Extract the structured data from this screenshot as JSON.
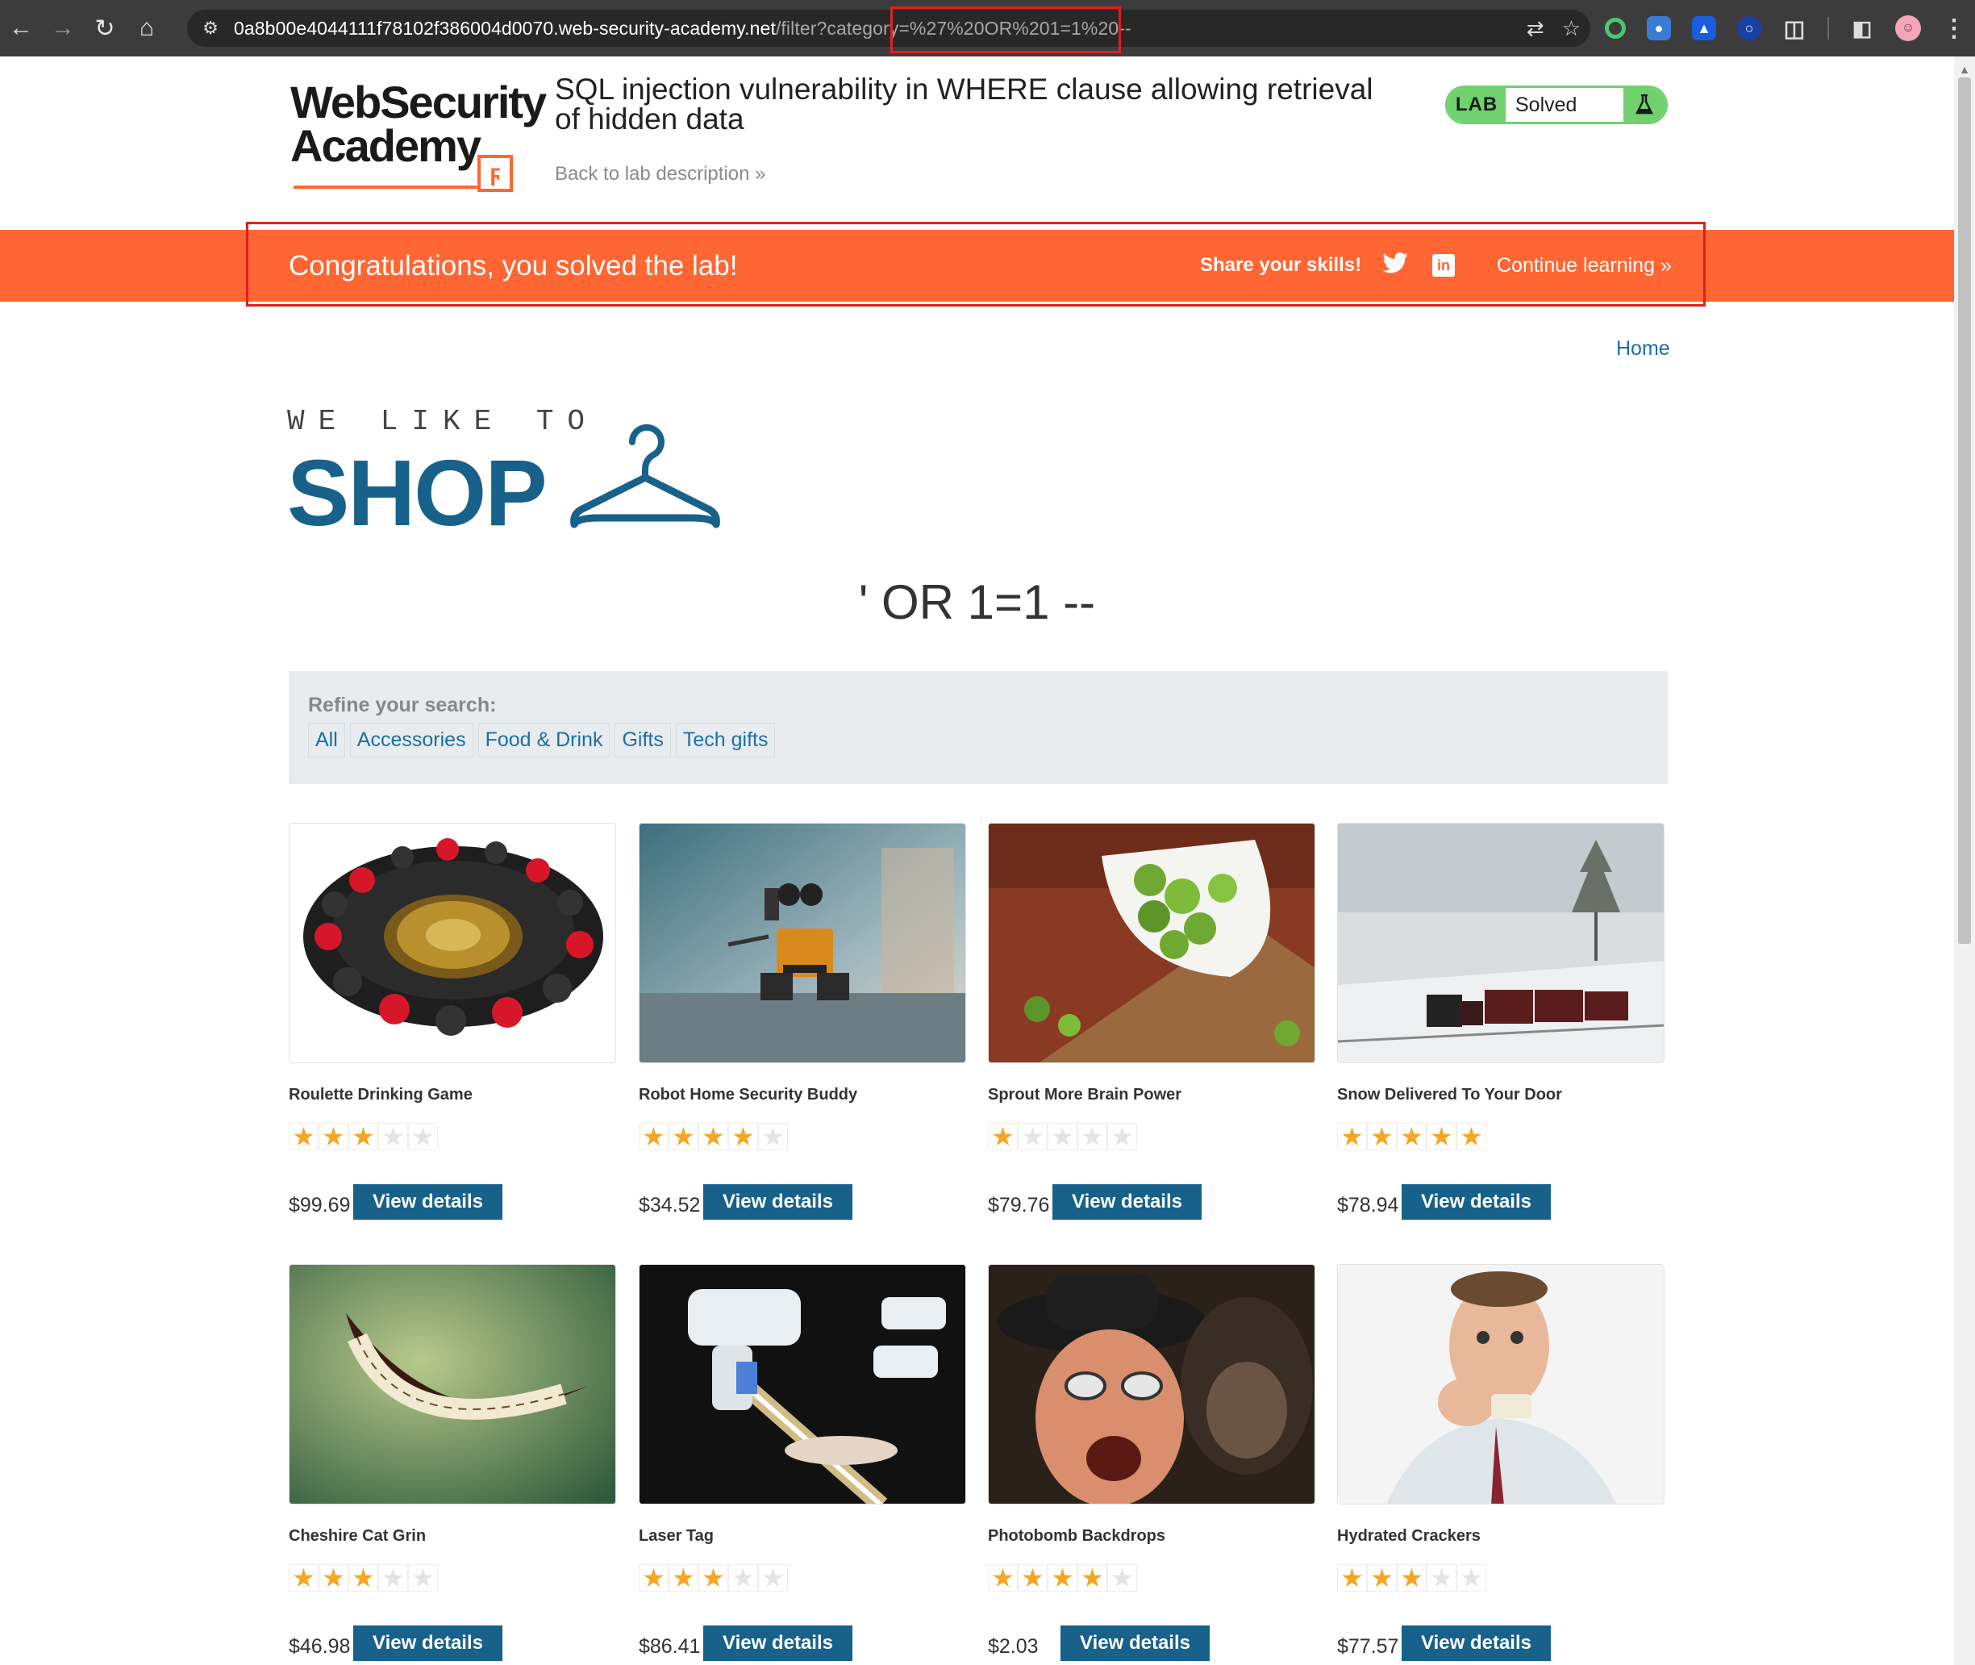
{
  "browser": {
    "url_host": "0a8b00e4044111f78102f386004d0070.web-security-academy.net",
    "url_path": "/filter?category=%27%20OR%201=1%20--"
  },
  "academy": {
    "logo_line1": "WebSecurity",
    "logo_line2": "Academy",
    "lab_title": "SQL injection vulnerability in WHERE clause allowing retrieval of hidden data",
    "back_link": "Back to lab description",
    "lab_tag": "LAB",
    "lab_status": "Solved"
  },
  "banner": {
    "message": "Congratulations, you solved the lab!",
    "share": "Share your skills!",
    "continue": "Continue learning"
  },
  "shop": {
    "home": "Home",
    "logo_small": "WE LIKE TO",
    "logo_big": "SHOP",
    "category_title": "' OR 1=1 --",
    "refine_label": "Refine your search:",
    "filters": [
      "All",
      "Accessories",
      "Food & Drink",
      "Gifts",
      "Tech gifts"
    ],
    "view_details": "View details",
    "products": [
      {
        "name": "Roulette Drinking Game",
        "rating": 3,
        "price": "$99.69",
        "image": "roulette-wheel"
      },
      {
        "name": "Robot Home Security Buddy",
        "rating": 4,
        "price": "$34.52",
        "image": "robot-toy"
      },
      {
        "name": "Sprout More Brain Power",
        "rating": 1,
        "price": "$79.76",
        "image": "brussels-sprouts"
      },
      {
        "name": "Snow Delivered To Your Door",
        "rating": 5,
        "price": "$78.94",
        "image": "snowy-train"
      },
      {
        "name": "Cheshire Cat Grin",
        "rating": 3,
        "price": "$46.98",
        "image": "cat-grin"
      },
      {
        "name": "Laser Tag",
        "rating": 3,
        "price": "$86.41",
        "image": "laser-guns"
      },
      {
        "name": "Photobomb Backdrops",
        "rating": 4,
        "price": "$2.03",
        "image": "man-and-monkey"
      },
      {
        "name": "Hydrated Crackers",
        "rating": 3,
        "price": "$77.57",
        "image": "man-eating-cracker"
      }
    ]
  },
  "colors": {
    "banner": "#ff6633",
    "brand_blue": "#17618a",
    "link_blue": "#1c6ea4",
    "lab_green": "#70d16e",
    "star": "#f5a623",
    "annotation": "#e02020"
  }
}
